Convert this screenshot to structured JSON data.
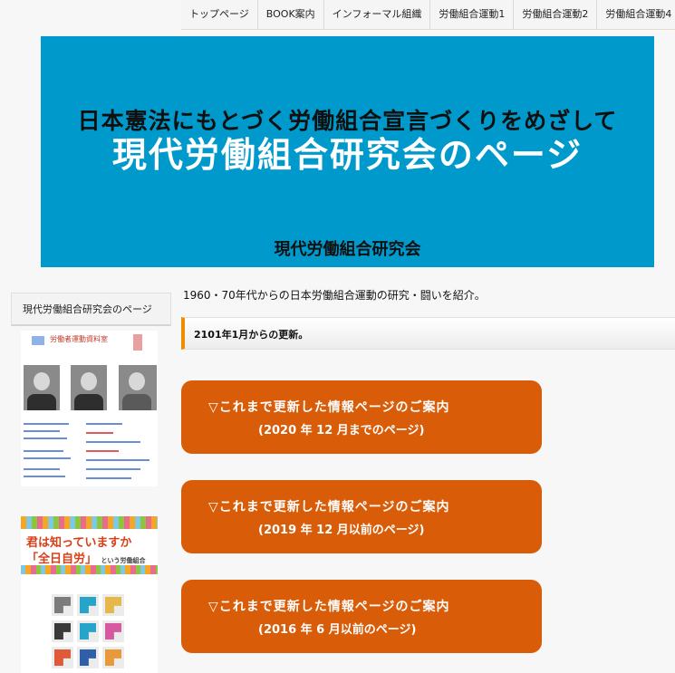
{
  "nav": [
    "トップページ",
    "BOOK案内",
    "インフォーマル組織",
    "労働組合運動1",
    "労働組合運動2",
    "労働組合運動4"
  ],
  "hero": {
    "subtitle": "日本憲法にもとづく労働組合宣言づくりをめざして",
    "title": "現代労働組合研究会のページ",
    "org": "現代労働組合研究会",
    "bg_color": "#0099cc"
  },
  "sidebar": {
    "heading": "現代労働組合研究会のページ",
    "doc_thumb_title": "労働者運動資料室",
    "book": {
      "line1": "君は知っていますか",
      "line2": "「全日自労」",
      "line2_small": "という労働組合"
    }
  },
  "main": {
    "intro": "1960・70年代からの日本労働組合運動の研究・闘いを紹介。",
    "update_bar": "2101年1月からの更新。",
    "accent_color": "#d95c08",
    "buttons": [
      {
        "line1": "▽これまで更新した情報ページのご案内",
        "line2": "(2020 年 12 月までのページ)"
      },
      {
        "line1": "▽これまで更新した情報ページのご案内",
        "line2": "(2019 年 12 月以前のページ)"
      },
      {
        "line1": "▽これまで更新した情報ページのご案内",
        "line2": "(2016 年 6 月以前のページ)"
      }
    ]
  }
}
